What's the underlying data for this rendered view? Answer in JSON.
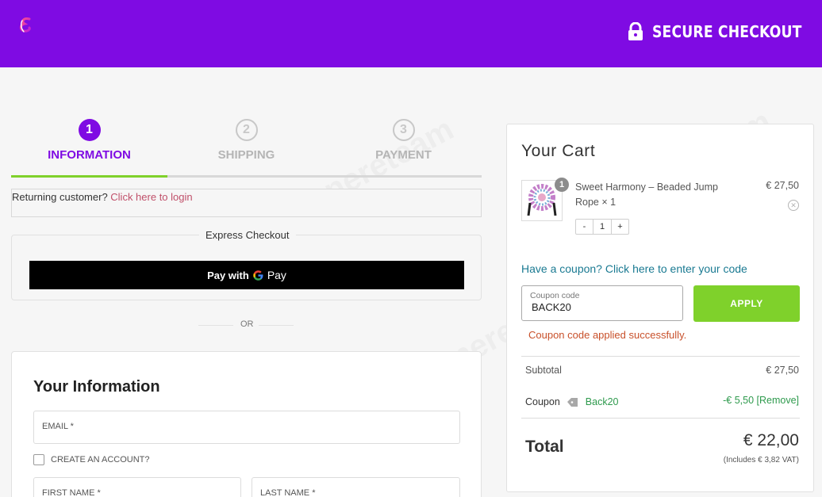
{
  "header": {
    "secure_checkout": "SECURE CHECKOUT",
    "brand_color": "#7f0be3"
  },
  "steps": [
    {
      "num": "1",
      "label": "INFORMATION",
      "active": true
    },
    {
      "num": "2",
      "label": "SHIPPING",
      "active": false
    },
    {
      "num": "3",
      "label": "PAYMENT",
      "active": false
    }
  ],
  "returning": {
    "text": "Returning customer? ",
    "link": "Click here to login"
  },
  "express": {
    "title": "Express Checkout",
    "pay_with": "Pay with",
    "gpay_g": "G",
    "gpay_pay": "Pay"
  },
  "or_text": "OR",
  "info": {
    "title": "Your Information",
    "email_label": "EMAIL *",
    "create_account": "CREATE AN ACCOUNT?",
    "first_name": "FIRST NAME *",
    "last_name": "LAST NAME *"
  },
  "cart": {
    "title": "Your Cart",
    "item": {
      "quantity_badge": "1",
      "name": "Sweet Harmony – Beaded Jump Rope × 1",
      "price": "€ 27,50",
      "minus": "-",
      "qty": "1",
      "plus": "+"
    },
    "coupon_link": "Have a coupon? Click here to enter your code",
    "coupon_label": "Coupon code",
    "coupon_value": "BACK20",
    "apply": "APPLY",
    "coupon_message": "Coupon code applied successfully.",
    "subtotal_label": "Subtotal",
    "subtotal_value": "€ 27,50",
    "coupon_row_label": "Coupon",
    "coupon_row_code": "Back20",
    "coupon_row_value": "-€ 5,50 [Remove]",
    "total_label": "Total",
    "total_value": "€ 22,00",
    "vat_note": "(Includes € 3,82 VAT)"
  },
  "watermark": "Tenereteam",
  "colors": {
    "accent_green": "#7fd12b",
    "link_teal": "#1a7a92",
    "success_green": "#2e9a4d",
    "message_orange": "#c8502a"
  }
}
